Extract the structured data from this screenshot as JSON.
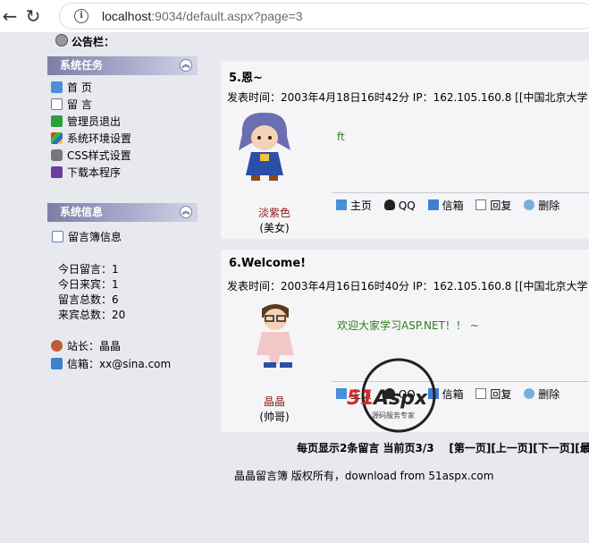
{
  "browser": {
    "url_host": "localhost",
    "url_rest": ":9034/default.aspx?page=3"
  },
  "notice": {
    "label": "公告栏："
  },
  "tasks_panel": {
    "title": "系统任务",
    "items": [
      "首 页",
      "留 言",
      "管理员退出",
      "系统环境设置",
      "CSS样式设置",
      "下载本程序"
    ]
  },
  "info_panel": {
    "title": "系统信息",
    "guestbook_info": "留言簿信息",
    "stats": [
      {
        "label": "今日留言：",
        "value": "1"
      },
      {
        "label": "今日来宾：",
        "value": "1"
      },
      {
        "label": "留言总数：",
        "value": "6"
      },
      {
        "label": "来宾总数：",
        "value": "20"
      }
    ],
    "webmaster_label": "站长：晶晶",
    "mailbox_label": "信箱：xx@sina.com"
  },
  "messages": [
    {
      "title": "5.恩~",
      "meta": "发表时间：2003年4月18日16时42分  IP：162.105.160.8  [[中国北京大学电子",
      "author": "淡紫色",
      "role": "(美女)",
      "content": "ft"
    },
    {
      "title": "6.Welcome!",
      "meta": "发表时间：2003年4月16日16时40分  IP：162.105.160.8  [[中国北京大学电子",
      "author": "晶晶",
      "role": "(帅哥)",
      "content": "欢迎大家学习ASP.NET！！ ~"
    }
  ],
  "actions": [
    "主页",
    "QQ",
    "信箱",
    "回复",
    "删除"
  ],
  "pager": {
    "summary": "每页显示2条留言 当前页3/3",
    "links": "[第一页][上一页][下一页][最后"
  },
  "footer": "晶晶留言簿 版权所有，download from 51aspx.com",
  "watermark": {
    "brand": "51Aspx",
    "tagline": "源码服务专家"
  }
}
